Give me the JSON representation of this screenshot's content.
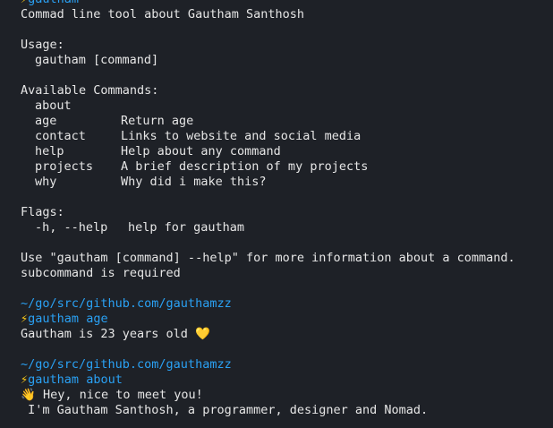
{
  "first_prompt": {
    "bolt": "⚡",
    "name": "gautham"
  },
  "help": {
    "description": "Commad line tool about Gautham Santhosh",
    "usage_heading": "Usage:",
    "usage_line": "gautham [command]",
    "commands_heading": "Available Commands:",
    "commands": [
      {
        "name": "about",
        "desc": ""
      },
      {
        "name": "age",
        "desc": "Return age"
      },
      {
        "name": "contact",
        "desc": "Links to website and social media"
      },
      {
        "name": "help",
        "desc": "Help about any command"
      },
      {
        "name": "projects",
        "desc": "A brief description of my projects"
      },
      {
        "name": "why",
        "desc": "Why did i make this?"
      }
    ],
    "flags_heading": "Flags:",
    "flag_name": "-h, --help",
    "flag_desc": "help for gautham",
    "footer": "Use \"gautham [command] --help\" for more information about a command.",
    "error": "subcommand is required"
  },
  "session_age": {
    "path": "~/go/src/github.com/gauthamzz",
    "bolt": "⚡",
    "prompt": "gautham",
    "command": "age",
    "output": "Gautham is 23 years old",
    "output_emoji": "💛"
  },
  "session_about": {
    "path": "~/go/src/github.com/gauthamzz",
    "bolt": "⚡",
    "prompt": "gautham",
    "command": "about",
    "emoji": "👋",
    "line1": "Hey, nice to meet you!",
    "line2": " I'm Gautham Santhosh, a programmer, designer and Nomad."
  },
  "colors": {
    "background": "#1e2127",
    "text": "#e6e6e6",
    "prompt_blue": "#2aa1f4",
    "bolt_yellow": "#f5c518"
  }
}
